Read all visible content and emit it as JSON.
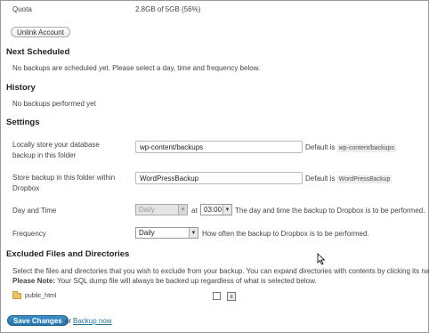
{
  "quota": {
    "label": "Quota",
    "value": "2.8GB of 5GB (56%)"
  },
  "unlink_label": "Unlink Account",
  "next_scheduled": {
    "heading": "Next Scheduled",
    "text": "No backups are scheduled yet. Please select a day, time and frequency below."
  },
  "history": {
    "heading": "History",
    "text": "No backups performed yet"
  },
  "settings": {
    "heading": "Settings",
    "local_store": {
      "label_line1": "Locally store your database",
      "label_line2": "backup in this folder",
      "value": "wp-content/backups",
      "default_prefix": "Default is",
      "default_value": "wp-content/backups"
    },
    "dropbox_folder": {
      "label_line1": "Store backup in this folder within",
      "label_line2": "Dropbox",
      "value": "WordPressBackup",
      "default_prefix": "Default is",
      "default_value": "WordPressBackup"
    },
    "day_time": {
      "label": "Day and Time",
      "day_value": "Daily",
      "at": "at",
      "time_value": "03:00",
      "help": "The day and time the backup to Dropbox is to be performed."
    },
    "frequency": {
      "label": "Frequency",
      "value": "Daily",
      "help": "How often the backup to Dropbox is to be performed."
    }
  },
  "excluded": {
    "heading": "Excluded Files and Directories",
    "desc": "Select the files and directories that you wish to exclude from your backup. You can expand directories with contents by clicking its name.",
    "note_bold": "Please Note:",
    "note_text": " Your SQL dump file will always be backed up regardless of what is selected below.",
    "items": [
      {
        "name": "public_html"
      }
    ]
  },
  "footer": {
    "save_label": "Save Changes",
    "or": "or",
    "backup_now": "Backup now"
  }
}
